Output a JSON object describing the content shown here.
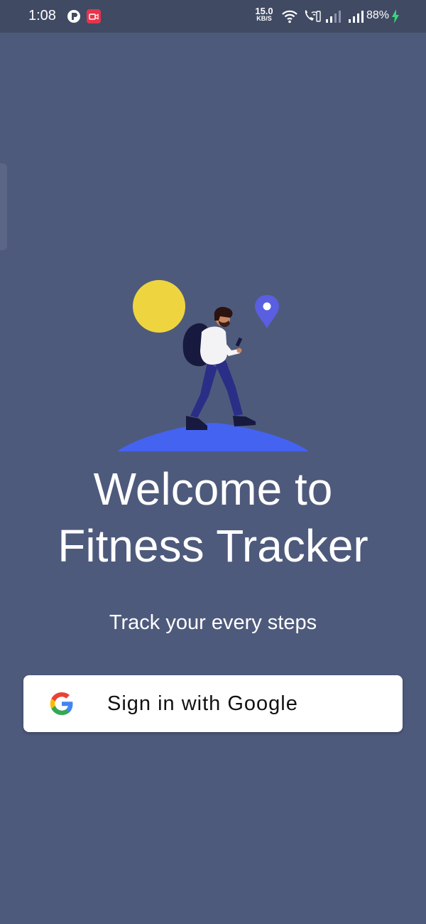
{
  "status_bar": {
    "time": "1:08",
    "net_speed_value": "15.0",
    "net_speed_unit": "KB/S",
    "battery": "88%",
    "icons": [
      "app-icon",
      "screen-record-icon",
      "wifi-icon",
      "wifi-calling-icon",
      "signal-icon",
      "signal-icon",
      "charging-icon"
    ]
  },
  "welcome": {
    "title_line1": "Welcome to",
    "title_line2": "Fitness Tracker",
    "subtitle": "Track your every steps"
  },
  "sign_in": {
    "label": "Sign in with Google",
    "icon": "google-icon"
  },
  "colors": {
    "background": "#4e5a7c",
    "status_bar": "#404a63",
    "sun": "#eed540",
    "ground": "#4463f0",
    "pin": "#5a5ee0",
    "button": "#ffffff"
  }
}
